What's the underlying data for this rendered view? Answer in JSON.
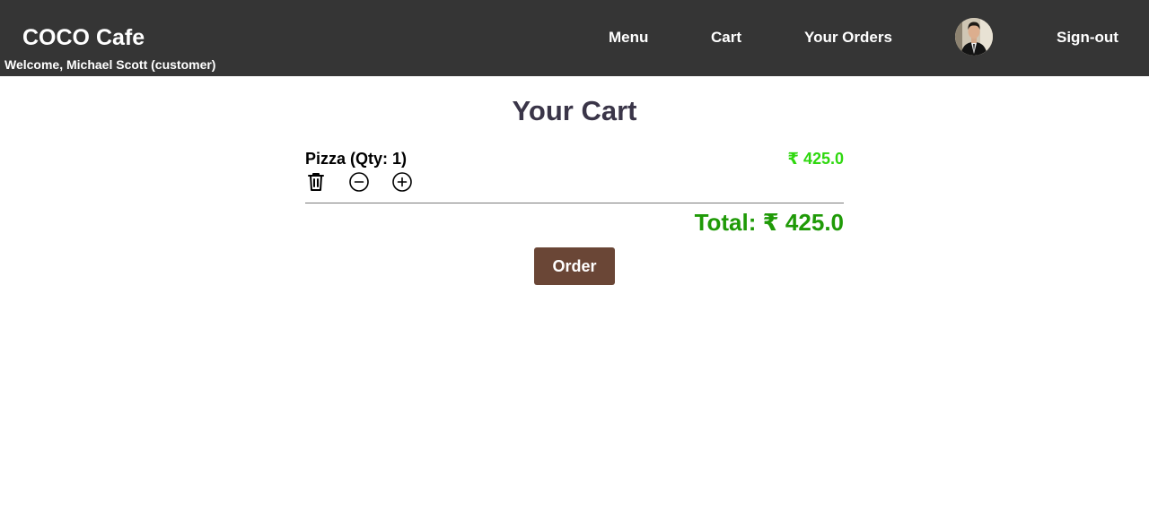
{
  "header": {
    "brand": "COCO Cafe",
    "welcome": "Welcome, Michael Scott (customer)",
    "nav": {
      "menu": "Menu",
      "cart": "Cart",
      "orders": "Your Orders",
      "signout": "Sign-out"
    },
    "avatar_icon": "user-avatar",
    "bg_color": "#353535"
  },
  "main": {
    "title": "Your Cart",
    "items": [
      {
        "name": "Pizza (Qty: 1)",
        "price": "₹ 425.0",
        "actions": [
          "trash-icon",
          "minus-circle-icon",
          "plus-circle-icon"
        ]
      }
    ],
    "total": "Total: ₹ 425.0",
    "order_button": "Order"
  },
  "colors": {
    "title": "#3a3548",
    "item_price": "#2fd80f",
    "total": "#1f9a07",
    "order_button": "#6a4636"
  }
}
